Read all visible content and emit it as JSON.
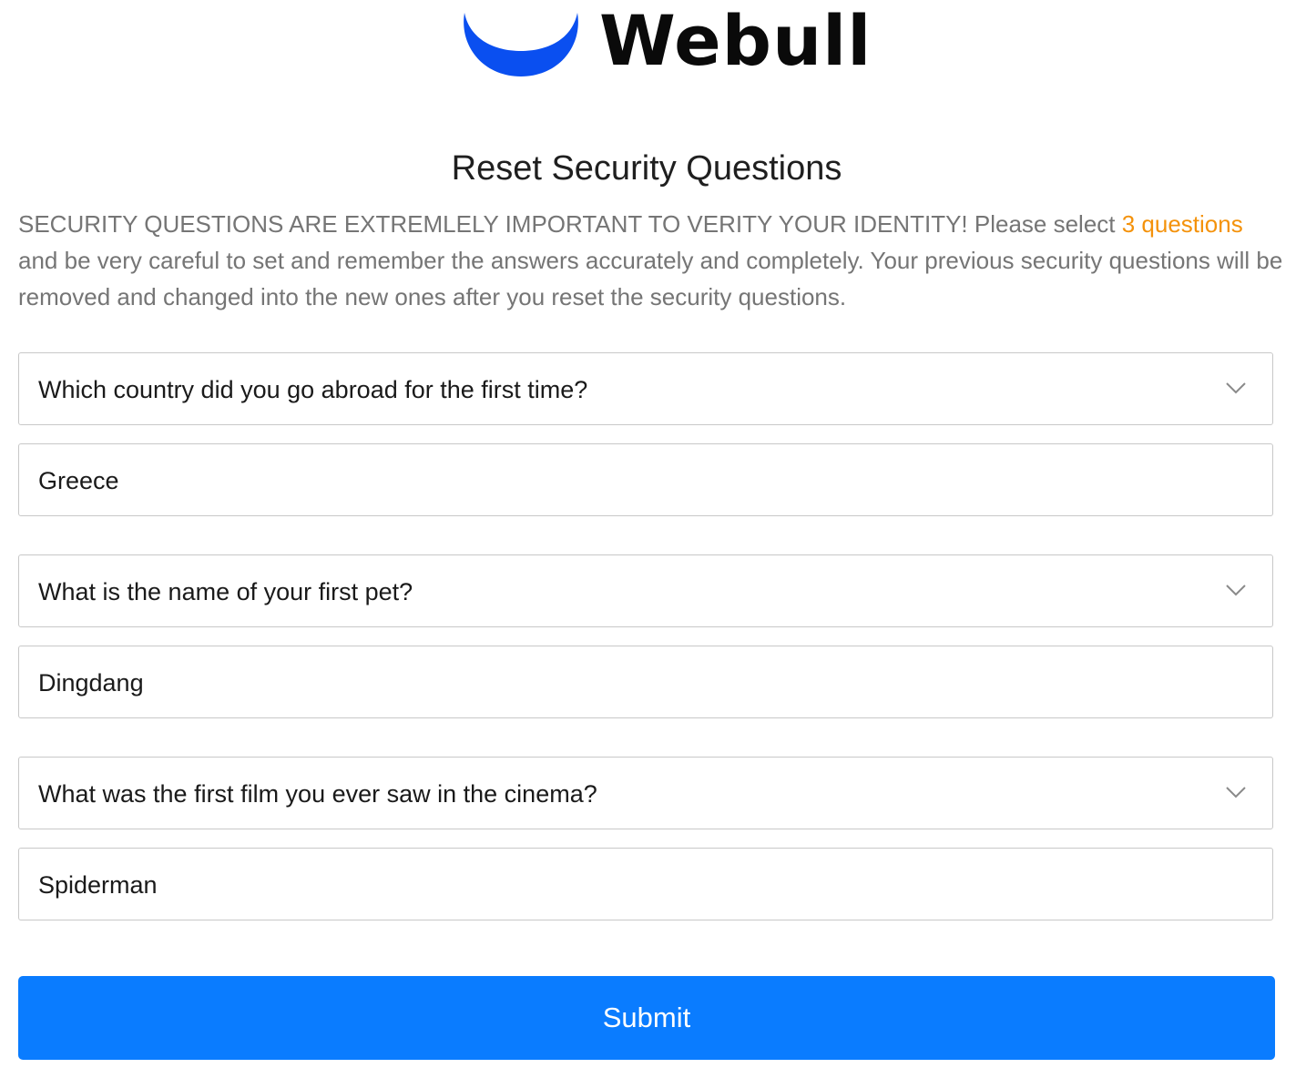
{
  "brand": {
    "name": "Webull",
    "logo_icon": "webull-crescent-icon",
    "logo_color": "#0a4ff0"
  },
  "page_title": "Reset Security Questions",
  "notice": {
    "prefix": "SECURITY QUESTIONS ARE EXTREMLELY IMPORTANT TO VERITY YOUR IDENTITY! Please select ",
    "highlight": "3 questions",
    "suffix": " and be very careful to set and remember the answers accurately and completely. Your previous security questions will be removed and changed into the new ones after you reset the security questions.",
    "highlight_color": "#f4920b"
  },
  "questions": [
    {
      "question": "Which country did you go abroad for the first time?",
      "answer": "Greece"
    },
    {
      "question": "What is the name of your first pet?",
      "answer": "Dingdang"
    },
    {
      "question": "What was the first film you ever saw in the cinema?",
      "answer": "Spiderman"
    }
  ],
  "submit_label": "Submit",
  "colors": {
    "primary": "#0a7cff",
    "notice_text": "#757575",
    "border": "#c8c8c8"
  }
}
